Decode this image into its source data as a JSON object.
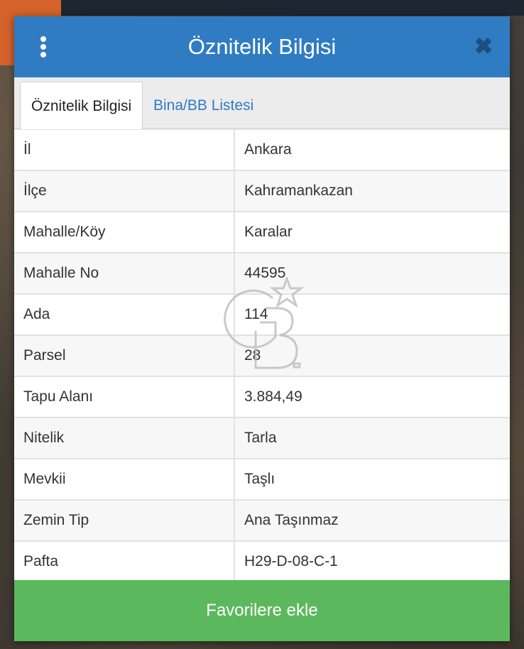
{
  "dialog": {
    "title": "Öznitelik Bilgisi",
    "close_symbol": "✖",
    "tabs": [
      {
        "label": "Öznitelik Bilgisi",
        "active": true
      },
      {
        "label": "Bina/BB Listesi",
        "active": false
      }
    ],
    "rows": [
      {
        "key": "İl",
        "value": "Ankara"
      },
      {
        "key": "İlçe",
        "value": "Kahramankazan"
      },
      {
        "key": "Mahalle/Köy",
        "value": "Karalar"
      },
      {
        "key": "Mahalle No",
        "value": "44595"
      },
      {
        "key": "Ada",
        "value": "114"
      },
      {
        "key": "Parsel",
        "value": "28"
      },
      {
        "key": "Tapu Alanı",
        "value": "3.884,49"
      },
      {
        "key": "Nitelik",
        "value": "Tarla"
      },
      {
        "key": "Mevkii",
        "value": "Taşlı"
      },
      {
        "key": "Zemin Tip",
        "value": "Ana Taşınmaz"
      },
      {
        "key": "Pafta",
        "value": "H29-D-08-C-1"
      }
    ],
    "footer_button": "Favorilere ekle"
  },
  "icons": {
    "menu": "kebab-menu-icon",
    "close": "close-icon",
    "watermark": "gb-logo-watermark"
  },
  "colors": {
    "header": "#2f7cc3",
    "close_icon": "#1c4f80",
    "tab_link": "#2f7cc3",
    "footer": "#5cb85c"
  }
}
